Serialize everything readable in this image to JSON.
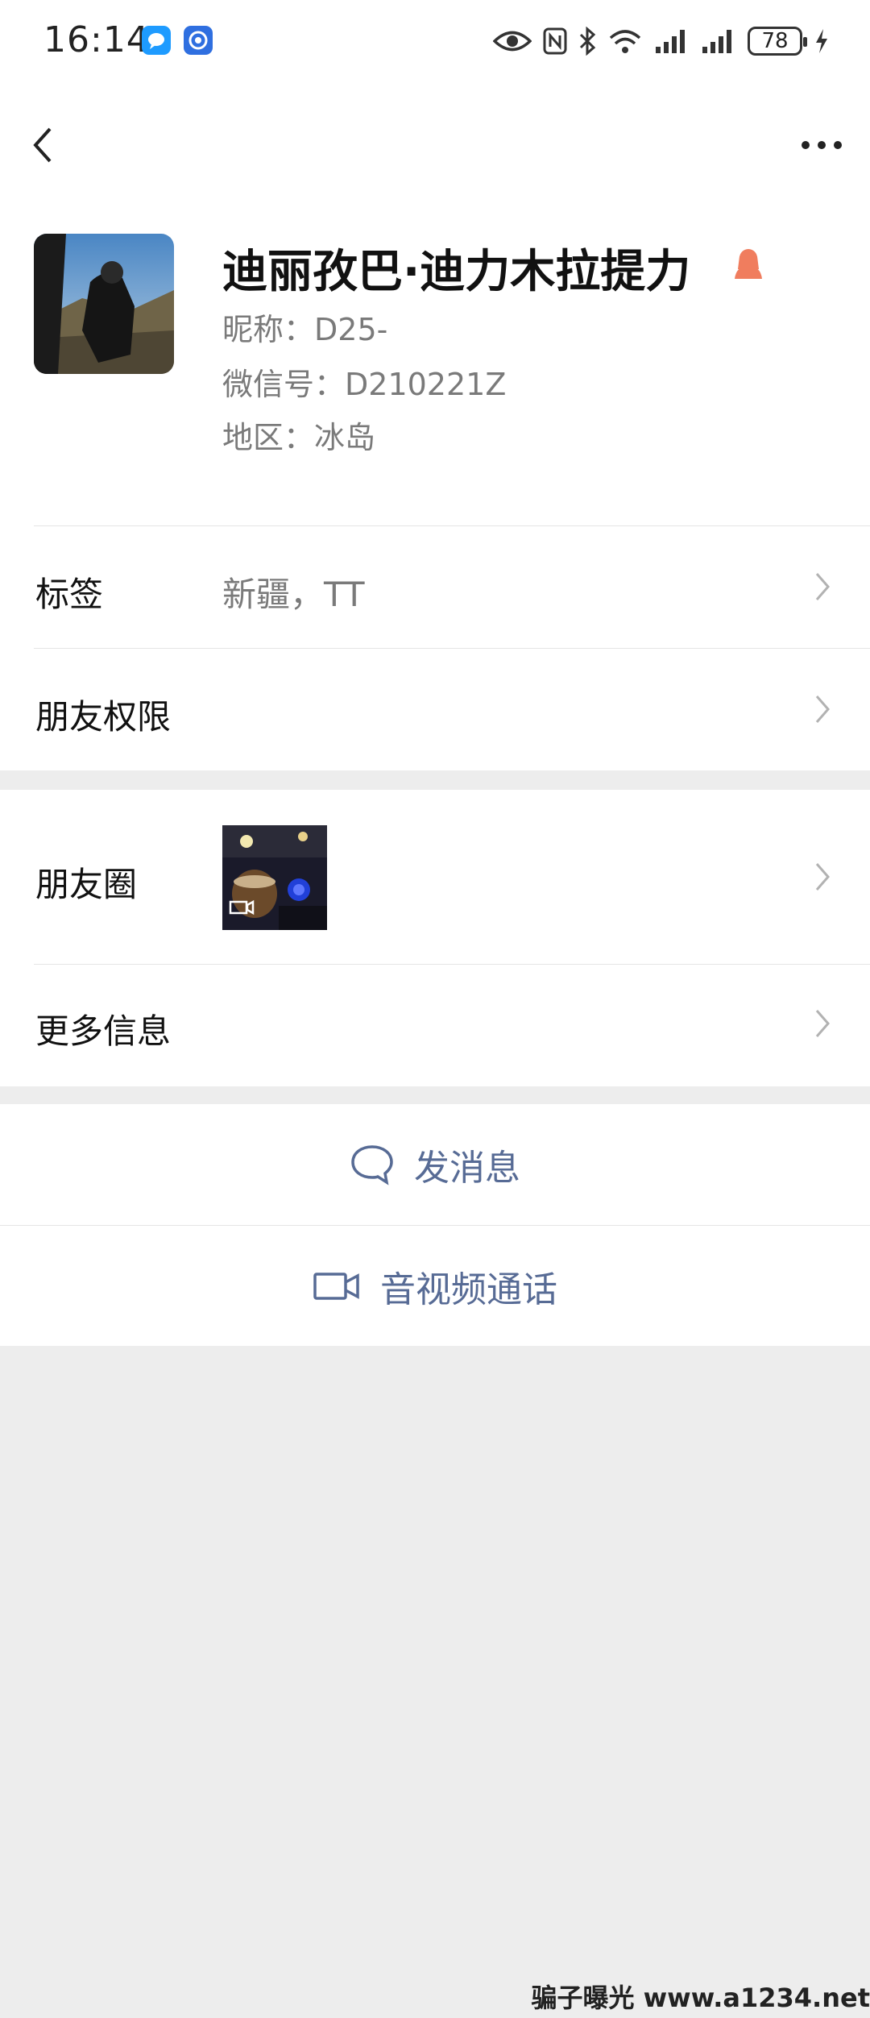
{
  "status_bar": {
    "time": "16:14",
    "battery": "78"
  },
  "profile": {
    "name": "迪丽孜巴·迪力木拉提力",
    "nickname": "昵称：D25-",
    "wechat_id": "微信号：D210221Z",
    "region": "地区：冰岛"
  },
  "rows": {
    "tags_label": "标签",
    "tags_value": "新疆，TT",
    "permissions_label": "朋友权限",
    "moments_label": "朋友圈",
    "more_label": "更多信息"
  },
  "actions": {
    "message": "发消息",
    "call": "音视频通话"
  },
  "watermark": "骗子曝光 www.a1234.net",
  "colors": {
    "link": "#576b95",
    "gender_icon": "#f07d5e",
    "background": "#ededed"
  }
}
